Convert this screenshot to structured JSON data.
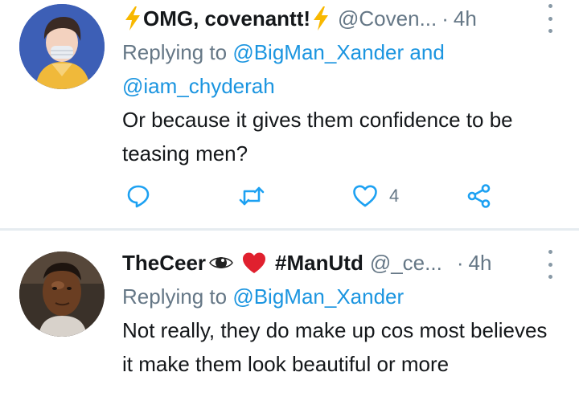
{
  "tweets": [
    {
      "display_name": "OMG, covenantt!",
      "handle": "@Coven...",
      "separator": "·",
      "time": "4h",
      "replying_prefix": "Replying to",
      "replying_to_1": "@BigMan_Xander",
      "replying_joiner": "and",
      "replying_to_2": "@iam_chyderah",
      "text": "Or because it gives them confidence to be teasing men?",
      "like_count": "4"
    },
    {
      "display_name": "TheCeer",
      "name_suffix": "#ManUtd",
      "handle": "@_ce...",
      "separator": "·",
      "time": "4h",
      "replying_prefix": "Replying to",
      "replying_to_1": "@BigMan_Xander",
      "text": "Not really, they do make up cos most believes it make them look beautiful or more"
    }
  ],
  "icons": {
    "name_emoji_1": "high-voltage-emoji",
    "name_emoji_2": "eye-emoji",
    "name_emoji_3": "red-heart-emoji",
    "reply": "reply-icon",
    "retweet": "retweet-icon",
    "like": "heart-icon",
    "share": "share-icon",
    "more": "more-vertical-icon"
  },
  "colors": {
    "link": "#1b95e0",
    "secondary_text": "#657786",
    "action_icon": "#1da1f2",
    "divider": "#e6ecf0"
  }
}
